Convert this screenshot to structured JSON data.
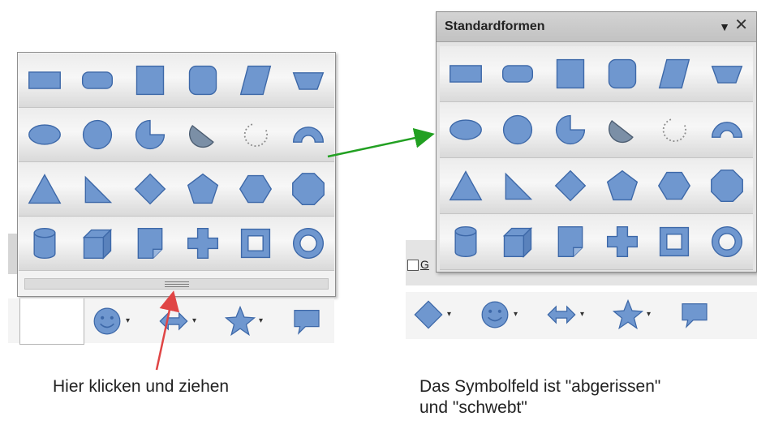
{
  "left_panel": {
    "rows": [
      [
        "rectangle-icon",
        "rounded-rectangle-icon",
        "square-icon",
        "rounded-square-icon",
        "parallelogram-icon",
        "trapezoid-icon"
      ],
      [
        "ellipse-icon",
        "circle-icon",
        "circle-pie-icon",
        "ellipse-segment-icon",
        "arc-icon",
        "block-arc-icon"
      ],
      [
        "triangle-icon",
        "right-triangle-icon",
        "diamond-icon",
        "pentagon-icon",
        "hexagon-icon",
        "octagon-icon"
      ],
      [
        "cylinder-icon",
        "cube-icon",
        "folded-corner-icon",
        "cross-icon",
        "frame-icon",
        "ring-icon"
      ]
    ],
    "caption": "Hier klicken und ziehen"
  },
  "right_window": {
    "title": "Standardformen",
    "menu_glyph": "▼",
    "close_glyph": "✕",
    "fragment_label": "G",
    "caption_line1": "Das Symbolfeld ist \"abgerissen\"",
    "caption_line2": "und \"schwebt\""
  },
  "toolbar": {
    "items": [
      "diamond-icon",
      "smiley-icon",
      "double-arrow-icon",
      "star-icon",
      "callout-icon"
    ],
    "dropdown_glyph": "▾"
  },
  "colors": {
    "shape_fill": "#6f97cf",
    "shape_stroke": "#3d68a8",
    "arrow_green": "#22a022",
    "arrow_red": "#e04545"
  }
}
